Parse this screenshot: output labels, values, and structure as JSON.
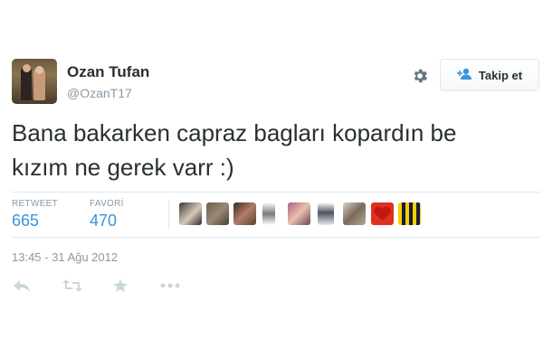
{
  "user": {
    "name": "Ozan Tufan",
    "handle": "@OzanT17"
  },
  "follow_button": {
    "label": "Takip et",
    "icon": "add-person-icon"
  },
  "tweet": {
    "text_line1": "Bana bakarken capraz bagları kopardın be",
    "text_line2": "kızım ne gerek varr :)"
  },
  "stats": {
    "retweet_label": "RETWEET",
    "retweet_count": "665",
    "favorite_label": "FAVORİ",
    "favorite_count": "470"
  },
  "favoriters_count_shown": 9,
  "timestamp": "13:45 - 31 Ağu 2012",
  "actions": [
    "reply-icon",
    "retweet-icon",
    "favorite-star-icon",
    "more-icon"
  ],
  "colors": {
    "link_blue": "#3b94d9",
    "muted": "#8899a6",
    "text": "#292f33",
    "border": "#e1e8ed"
  }
}
